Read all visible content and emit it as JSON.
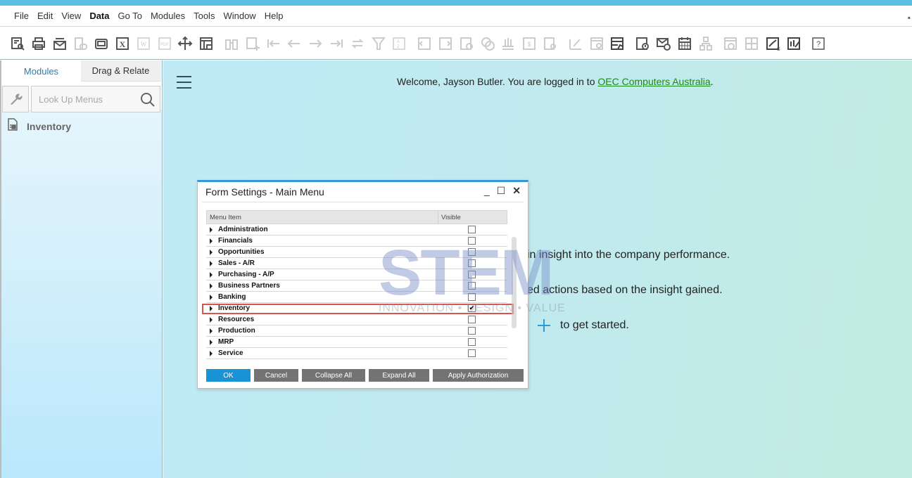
{
  "menubar": {
    "items": [
      {
        "label": "File",
        "accel": "F",
        "bold": false
      },
      {
        "label": "Edit",
        "accel": "E",
        "bold": false
      },
      {
        "label": "View",
        "accel": "V",
        "bold": false
      },
      {
        "label": "Data",
        "accel": "D",
        "bold": true
      },
      {
        "label": "Go To",
        "accel": "G",
        "bold": false
      },
      {
        "label": "Modules",
        "accel": "M",
        "bold": false
      },
      {
        "label": "Tools",
        "accel": "T",
        "bold": false
      },
      {
        "label": "Window",
        "accel": "W",
        "bold": false
      },
      {
        "label": "Help",
        "accel": "H",
        "bold": false
      }
    ]
  },
  "toolbar": {
    "icons": [
      {
        "name": "preview-icon",
        "enabled": true
      },
      {
        "name": "print-icon",
        "enabled": true
      },
      {
        "name": "email-icon",
        "enabled": true
      },
      {
        "name": "sms-icon",
        "enabled": false
      },
      {
        "name": "fax-icon",
        "enabled": true
      },
      {
        "name": "excel-icon",
        "enabled": true
      },
      {
        "name": "word-icon",
        "enabled": false
      },
      {
        "name": "pdf-icon",
        "enabled": false
      },
      {
        "name": "move-icon",
        "enabled": true
      },
      {
        "name": "lock-screen-icon",
        "enabled": true
      },
      {
        "name": "find-icon",
        "enabled": false
      },
      {
        "name": "add-icon",
        "enabled": false
      },
      {
        "name": "first-record-icon",
        "enabled": false
      },
      {
        "name": "previous-record-icon",
        "enabled": false
      },
      {
        "name": "next-record-icon",
        "enabled": false
      },
      {
        "name": "last-record-icon",
        "enabled": false
      },
      {
        "name": "refresh-icon",
        "enabled": false
      },
      {
        "name": "filter-icon",
        "enabled": false
      },
      {
        "name": "sort-icon",
        "enabled": false
      },
      {
        "name": "base-document-icon",
        "enabled": false
      },
      {
        "name": "target-document-icon",
        "enabled": false
      },
      {
        "name": "payment-means-icon",
        "enabled": false
      },
      {
        "name": "currency-icon",
        "enabled": false
      },
      {
        "name": "balance-icon",
        "enabled": false
      },
      {
        "name": "journal-icon",
        "enabled": false
      },
      {
        "name": "gross-profit-icon",
        "enabled": false
      },
      {
        "name": "edit-icon",
        "enabled": false
      },
      {
        "name": "form-settings-icon",
        "enabled": false
      },
      {
        "name": "customize-form-icon",
        "enabled": true
      },
      {
        "name": "alerts-icon",
        "enabled": true
      },
      {
        "name": "messages-icon",
        "enabled": true
      },
      {
        "name": "calendar-icon",
        "enabled": true
      },
      {
        "name": "org-chart-icon",
        "enabled": false
      },
      {
        "name": "dashboard-icon",
        "enabled": false
      },
      {
        "name": "widgets-icon",
        "enabled": false
      },
      {
        "name": "analytics-icon",
        "enabled": true
      },
      {
        "name": "report-edit-icon",
        "enabled": true
      },
      {
        "name": "help-icon",
        "enabled": true
      }
    ]
  },
  "sidebar": {
    "tabs": [
      {
        "label": "Modules",
        "active": true
      },
      {
        "label": "Drag & Relate",
        "active": false
      }
    ],
    "search": {
      "placeholder": "Look Up Menus",
      "value": ""
    },
    "modules": [
      {
        "label": "Inventory",
        "icon": "inventory-icon"
      }
    ]
  },
  "main": {
    "welcome_prefix": "Welcome, Jayson Butler. You are logged in to ",
    "company_link": "OEC Computers Australia",
    "welcome_suffix": ".",
    "line1": "in insight into the company performance.",
    "line2": "ed actions based on the insight gained.",
    "line3": "to get started."
  },
  "watermark": {
    "letters": "STEM",
    "tagline": "INNOVATION • DESIGN • VALUE"
  },
  "dialog": {
    "title": "Form Settings - Main Menu",
    "columns": [
      "Menu Item",
      "Visible"
    ],
    "rows": [
      {
        "label": "Administration",
        "visible": false
      },
      {
        "label": "Financials",
        "visible": false
      },
      {
        "label": "Opportunities",
        "visible": false
      },
      {
        "label": "Sales - A/R",
        "visible": false
      },
      {
        "label": "Purchasing - A/P",
        "visible": false
      },
      {
        "label": "Business Partners",
        "visible": false
      },
      {
        "label": "Banking",
        "visible": false
      },
      {
        "label": "Inventory",
        "visible": true,
        "highlighted": true
      },
      {
        "label": "Resources",
        "visible": false
      },
      {
        "label": "Production",
        "visible": false
      },
      {
        "label": "MRP",
        "visible": false
      },
      {
        "label": "Service",
        "visible": false
      }
    ],
    "buttons": {
      "ok": "OK",
      "cancel": "Cancel",
      "collapse_all": "Collapse All",
      "expand_all": "Expand All",
      "apply_authorization": "Apply Authorization"
    },
    "highlight_color": "#d9534f",
    "accent_color": "#1a93d6"
  }
}
